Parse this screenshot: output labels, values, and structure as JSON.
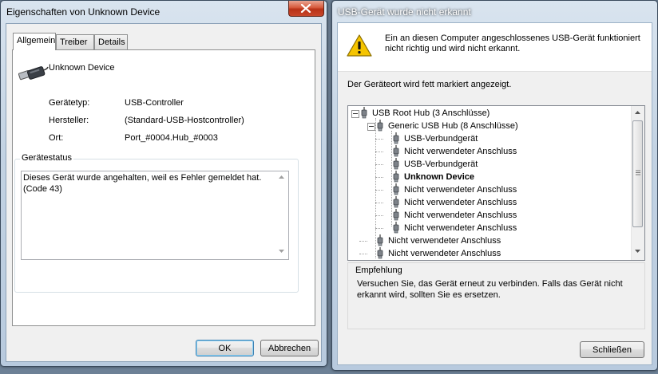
{
  "left_window": {
    "title": "Eigenschaften von Unknown Device",
    "tabs": [
      {
        "label": "Allgemein"
      },
      {
        "label": "Treiber"
      },
      {
        "label": "Details"
      }
    ],
    "device_name": "Unknown Device",
    "properties": [
      {
        "label": "Gerätetyp:",
        "value": "USB-Controller"
      },
      {
        "label": "Hersteller:",
        "value": "(Standard-USB-Hostcontroller)"
      },
      {
        "label": "Ort:",
        "value": "Port_#0004.Hub_#0003"
      }
    ],
    "status_group_title": "Gerätestatus",
    "status_line1": "Dieses Gerät wurde angehalten, weil es Fehler gemeldet hat.",
    "status_line2": "(Code 43)",
    "ok_label": "OK",
    "cancel_label": "Abbrechen"
  },
  "right_window": {
    "title": "USB-Gerät wurde nicht erkannt",
    "warning_line1": "Ein an diesen Computer angeschlossenes USB-Gerät funktioniert",
    "warning_line2": "nicht richtig und wird nicht erkannt.",
    "location_note": "Der Geräteort wird fett markiert angezeigt.",
    "tree": [
      {
        "label": "USB Root Hub (3 Anschlüsse)",
        "level": 0,
        "expander": true,
        "bold": false
      },
      {
        "label": "Generic USB Hub (8 Anschlüsse)",
        "level": 1,
        "expander": true,
        "bold": false
      },
      {
        "label": "USB-Verbundgerät",
        "level": 2,
        "expander": false,
        "bold": false
      },
      {
        "label": "Nicht verwendeter Anschluss",
        "level": 2,
        "expander": false,
        "bold": false
      },
      {
        "label": "USB-Verbundgerät",
        "level": 2,
        "expander": false,
        "bold": false
      },
      {
        "label": "Unknown Device",
        "level": 2,
        "expander": false,
        "bold": true
      },
      {
        "label": "Nicht verwendeter Anschluss",
        "level": 2,
        "expander": false,
        "bold": false
      },
      {
        "label": "Nicht verwendeter Anschluss",
        "level": 2,
        "expander": false,
        "bold": false
      },
      {
        "label": "Nicht verwendeter Anschluss",
        "level": 2,
        "expander": false,
        "bold": false
      },
      {
        "label": "Nicht verwendeter Anschluss",
        "level": 2,
        "expander": false,
        "bold": false
      },
      {
        "label": "Nicht verwendeter Anschluss",
        "level": 1,
        "expander": false,
        "bold": false
      },
      {
        "label": "Nicht verwendeter Anschluss",
        "level": 1,
        "expander": false,
        "bold": false
      }
    ],
    "recommendation_title": "Empfehlung",
    "recommendation_line1": "Versuchen Sie, das Gerät erneut zu verbinden. Falls das Gerät nicht",
    "recommendation_line2": "erkannt wird, sollten Sie es ersetzen.",
    "close_label": "Schließen"
  },
  "icons": {
    "close": "close-icon",
    "usb_device": "usb-plug-icon",
    "warning": "warning-icon",
    "tree_node": "usb-port-icon"
  },
  "colors": {
    "close_button": "#c8472b",
    "warning": "#f5c400",
    "window_frame": "#c3d3e3"
  }
}
